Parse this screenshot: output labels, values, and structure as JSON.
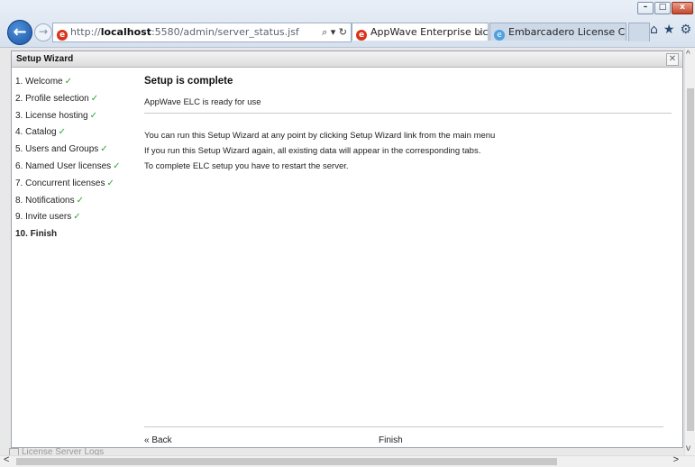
{
  "browser": {
    "url_host_prefix": "http://",
    "url_host": "localhost",
    "url_rest": ":5580/admin/server_status.jsf",
    "address_tools": "⌕ ▾ ↻",
    "tabs": [
      {
        "label": "AppWave Enterprise Lice...",
        "close": "×"
      },
      {
        "label": "Embarcadero License Cent..."
      }
    ],
    "window_controls": {
      "minimize": "–",
      "maximize": "□",
      "close": "x"
    },
    "back_glyph": "←",
    "forward_glyph": "→",
    "right_icons": [
      "home-icon",
      "star-icon",
      "gear-icon"
    ]
  },
  "background": {
    "license_server_logs": "License Server Logs"
  },
  "dialog": {
    "title": "Setup Wizard",
    "close_glyph": "✕",
    "steps": [
      {
        "label": "1. Welcome",
        "done": true
      },
      {
        "label": "2. Profile selection",
        "done": true
      },
      {
        "label": "3. License hosting",
        "done": true
      },
      {
        "label": "4. Catalog",
        "done": true
      },
      {
        "label": "5. Users and Groups",
        "done": true
      },
      {
        "label": "6. Named User licenses",
        "done": true
      },
      {
        "label": "7. Concurrent licenses",
        "done": true
      },
      {
        "label": "8. Notifications",
        "done": true
      },
      {
        "label": "9. Invite users",
        "done": true
      },
      {
        "label": "10. Finish",
        "done": false,
        "current": true
      }
    ],
    "check_glyph": "✓",
    "heading": "Setup is complete",
    "subheading": "AppWave ELC is ready for use",
    "lines": [
      "You can run this Setup Wizard at any point by clicking Setup Wizard link from the main menu",
      "If you run this Setup Wizard again, all existing data will appear in the corresponding tabs.",
      "To complete ELC setup you have to restart the server."
    ],
    "back_label": "« Back",
    "finish_label": "Finish"
  },
  "colors": {
    "check": "#2fa52f",
    "ie_red": "#d9331a"
  }
}
